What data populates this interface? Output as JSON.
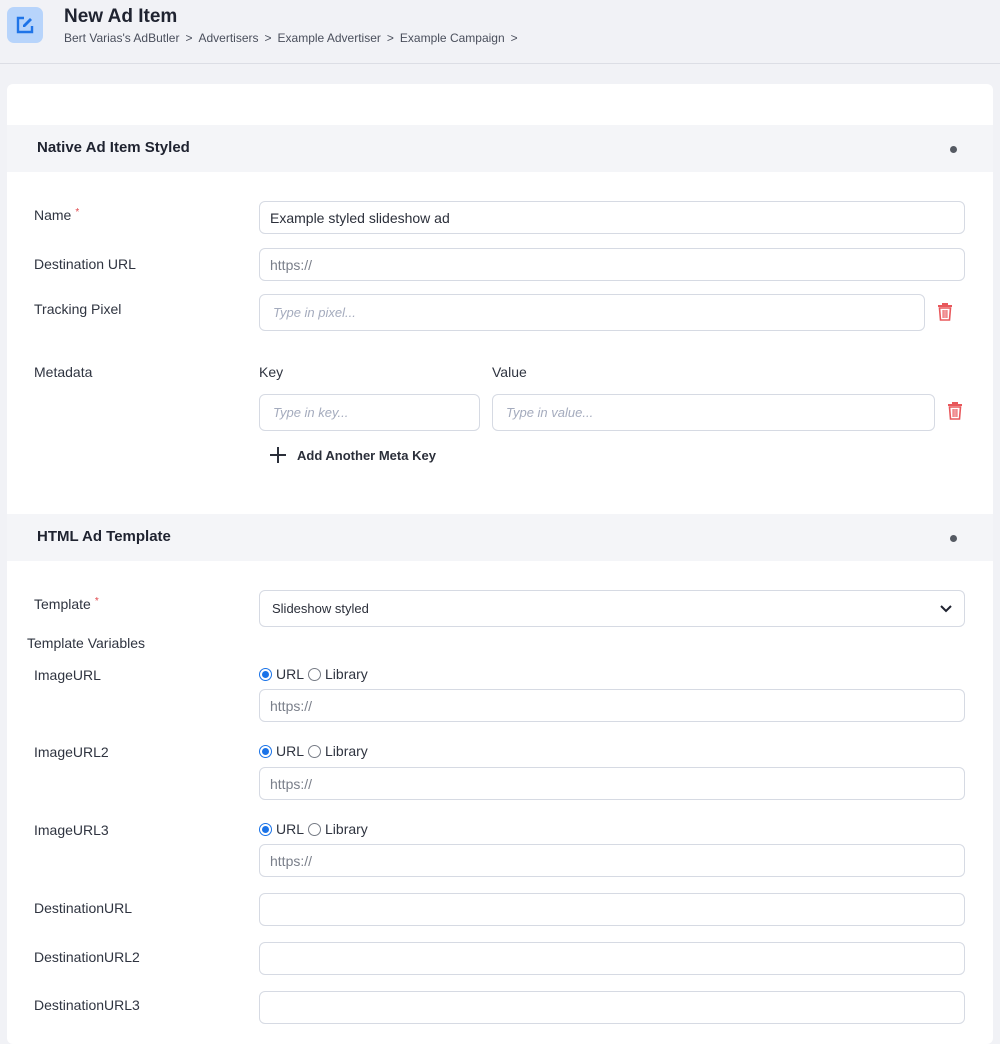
{
  "header": {
    "title": "New Ad Item",
    "icon": "edit-square-icon",
    "breadcrumb": [
      "Bert Varias's AdButler",
      "Advertisers",
      "Example Advertiser",
      "Example Campaign"
    ],
    "separator": ">"
  },
  "native_section": {
    "title": "Native Ad Item Styled",
    "fields": {
      "name": {
        "label": "Name",
        "required_mark": "*",
        "value": "Example styled slideshow ad"
      },
      "destination_url": {
        "label": "Destination URL",
        "placeholder": "https://"
      },
      "tracking_pixel": {
        "label": "Tracking Pixel",
        "placeholder": "Type in pixel..."
      }
    },
    "metadata": {
      "label": "Metadata",
      "key_header": "Key",
      "value_header": "Value",
      "key_placeholder": "Type in key...",
      "value_placeholder": "Type in value...",
      "add_label": "Add Another Meta Key"
    }
  },
  "template_section": {
    "title": "HTML Ad Template",
    "template": {
      "label": "Template",
      "required_mark": "*",
      "selected": "Slideshow styled"
    },
    "variables_label": "Template Variables",
    "image_vars": [
      {
        "label": "ImageURL",
        "mode": "URL",
        "options": [
          "URL",
          "Library"
        ],
        "placeholder": "https://"
      },
      {
        "label": "ImageURL2",
        "mode": "URL",
        "options": [
          "URL",
          "Library"
        ],
        "placeholder": "https://"
      },
      {
        "label": "ImageURL3",
        "mode": "URL",
        "options": [
          "URL",
          "Library"
        ],
        "placeholder": "https://"
      }
    ],
    "dest_vars": [
      {
        "label": "DestinationURL",
        "value": ""
      },
      {
        "label": "DestinationURL2",
        "value": ""
      },
      {
        "label": "DestinationURL3",
        "value": ""
      }
    ]
  },
  "colors": {
    "accent": "#1a73e8",
    "danger": "#e8585c",
    "icon_bg": "#b7d4fb"
  }
}
